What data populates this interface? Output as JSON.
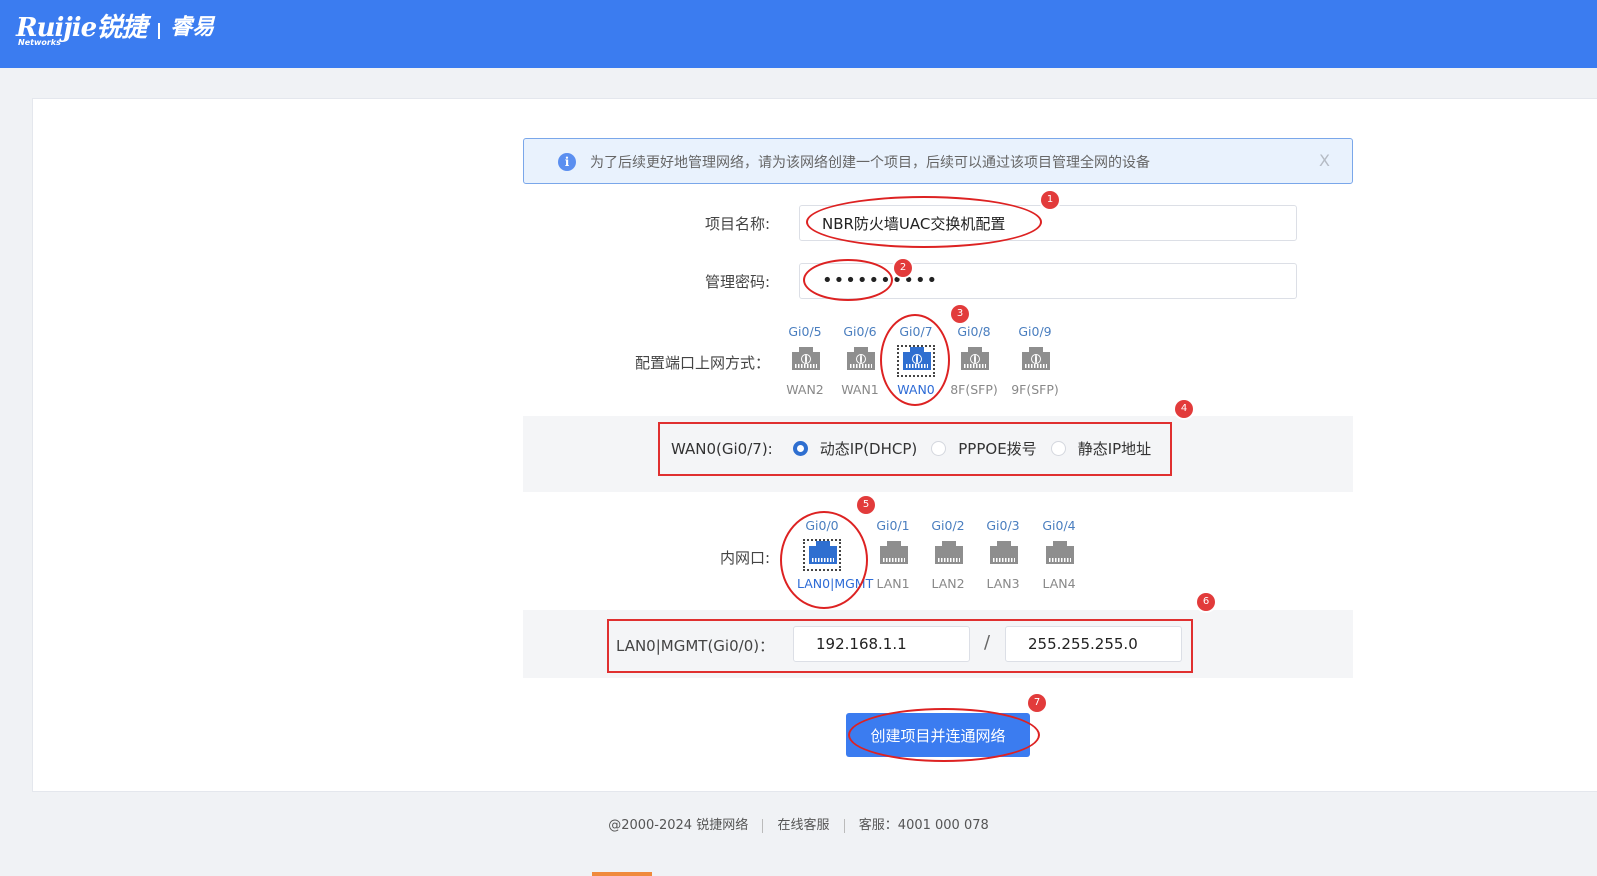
{
  "header": {
    "brand_logo": "Ruijie锐捷",
    "brand_sub": "Networks",
    "product": "睿易",
    "bg_color": "#3b7cf0"
  },
  "notice": {
    "icon": "info-icon",
    "text": "为了后续更好地管理网络，请为该网络创建一个项目，后续可以通过该项目管理全网的设备",
    "close": "X"
  },
  "form": {
    "project_name_label": "项目名称:",
    "project_name_value": "NBR防火墙UAC交换机配置",
    "password_label": "管理密码:",
    "password_value": "••••••••••",
    "uplink_label": "配置端口上网方式：",
    "uplink_ports": [
      {
        "top": "Gi0/5",
        "bottom": "WAN2",
        "selected": false
      },
      {
        "top": "Gi0/6",
        "bottom": "WAN1",
        "selected": false
      },
      {
        "top": "Gi0/7",
        "bottom": "WAN0",
        "selected": true
      },
      {
        "top": "Gi0/8",
        "bottom": "8F(SFP)",
        "selected": false
      },
      {
        "top": "Gi0/9",
        "bottom": "9F(SFP)",
        "selected": false
      }
    ],
    "wan_mode_label": "WAN0(Gi0/7):",
    "wan_modes": [
      {
        "label": "动态IP(DHCP)",
        "checked": true
      },
      {
        "label": "PPPOE拨号",
        "checked": false
      },
      {
        "label": "静态IP地址",
        "checked": false
      }
    ],
    "lan_label": "内网口:",
    "lan_ports": [
      {
        "top": "Gi0/0",
        "bottom": "LAN0|MGMT",
        "selected": true
      },
      {
        "top": "Gi0/1",
        "bottom": "LAN1",
        "selected": false
      },
      {
        "top": "Gi0/2",
        "bottom": "LAN2",
        "selected": false
      },
      {
        "top": "Gi0/3",
        "bottom": "LAN3",
        "selected": false
      },
      {
        "top": "Gi0/4",
        "bottom": "LAN4",
        "selected": false
      }
    ],
    "lan_ip_label": "LAN0|MGMT(Gi0/0)：",
    "lan_ip": "192.168.1.1",
    "lan_sep": "/",
    "lan_mask": "255.255.255.0",
    "submit_label": "创建项目并连通网络"
  },
  "annotations": [
    "1",
    "2",
    "3",
    "4",
    "5",
    "6",
    "7"
  ],
  "footer": {
    "copyright": "@2000-2024 锐捷网络",
    "online_service": "在线客服",
    "hotline": "客服：4001 000 078"
  }
}
